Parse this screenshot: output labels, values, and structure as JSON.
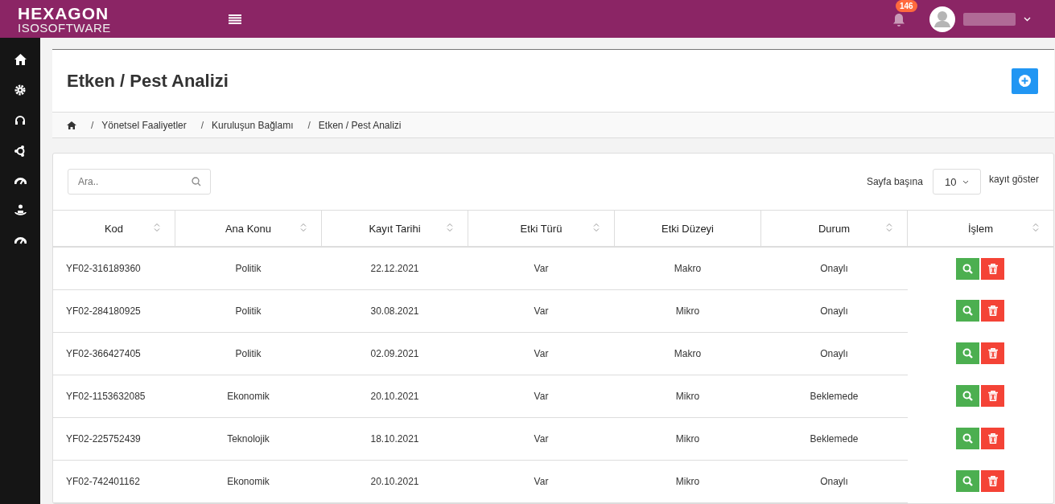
{
  "header": {
    "logo_top": "HEXAGON",
    "logo_bottom": "ISOSOFTWARE",
    "notification_count": "146"
  },
  "sidebar": {
    "items": [
      {
        "kind": "home"
      },
      {
        "kind": "gear"
      },
      {
        "kind": "headset"
      },
      {
        "kind": "network"
      },
      {
        "kind": "gauge"
      },
      {
        "kind": "person"
      },
      {
        "kind": "gauge"
      }
    ]
  },
  "page": {
    "title": "Etken / Pest Analizi"
  },
  "breadcrumb": {
    "separator": "/",
    "items": [
      "Yönetsel Faaliyetler",
      "Kuruluşun Bağlamı",
      "Etken / Pest Analizi"
    ]
  },
  "table_tools": {
    "search_placeholder": "Ara..",
    "per_page_label": "Sayfa başına",
    "per_page_value": "10",
    "per_page_suffix": "kayıt göster"
  },
  "table": {
    "columns": [
      {
        "label": "Kod",
        "sortable": true
      },
      {
        "label": "Ana Konu",
        "sortable": true
      },
      {
        "label": "Kayıt Tarihi",
        "sortable": true
      },
      {
        "label": "Etki Türü",
        "sortable": true
      },
      {
        "label": "Etki Düzeyi",
        "sortable": false
      },
      {
        "label": "Durum",
        "sortable": true
      },
      {
        "label": "İşlem",
        "sortable": true
      }
    ],
    "rows": [
      [
        "YF02-316189360",
        "Politik",
        "22.12.2021",
        "Var",
        "Makro",
        "Onaylı"
      ],
      [
        "YF02-284180925",
        "Politik",
        "30.08.2021",
        "Var",
        "Mikro",
        "Onaylı"
      ],
      [
        "YF02-366427405",
        "Politik",
        "02.09.2021",
        "Var",
        "Makro",
        "Onaylı"
      ],
      [
        "YF02-1153632085",
        "Ekonomik",
        "20.10.2021",
        "Var",
        "Mikro",
        "Beklemede"
      ],
      [
        "YF02-225752439",
        "Teknolojik",
        "18.10.2021",
        "Var",
        "Mikro",
        "Beklemede"
      ],
      [
        "YF02-742401162",
        "Ekonomik",
        "20.10.2021",
        "Var",
        "Mikro",
        "Onaylı"
      ]
    ]
  }
}
